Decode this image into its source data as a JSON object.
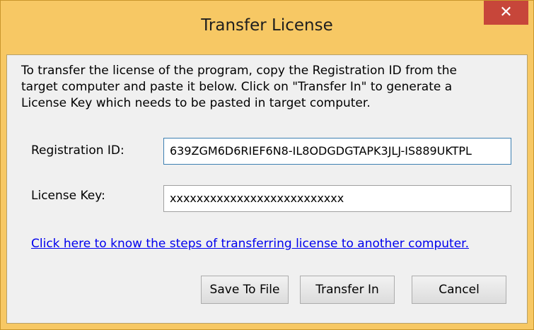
{
  "window": {
    "title": "Transfer License",
    "close_glyph": "✕"
  },
  "instructions": "To transfer the license of the program, copy the Registration ID from the\ntarget computer and paste it below. Click on \"Transfer In\" to generate a\nLicense Key which needs to be pasted in target computer.",
  "form": {
    "registration_label": "Registration ID:",
    "registration_value": "639ZGM6D6RIEF6N8-IL8ODGDGTAPK3JLJ-IS889UKTPL",
    "license_label": "License Key:",
    "license_value": "xxxxxxxxxxxxxxxxxxxxxxxxxx"
  },
  "help_link": "Click here to know the steps of transferring license to another computer.",
  "buttons": {
    "save": "Save To File",
    "transfer": "Transfer In",
    "cancel": "Cancel"
  },
  "colors": {
    "frame": "#f7c864",
    "close": "#c7463a",
    "link": "#0000ee",
    "focus_border": "#3c7fb1"
  },
  "icons": {
    "close": "close-icon"
  }
}
